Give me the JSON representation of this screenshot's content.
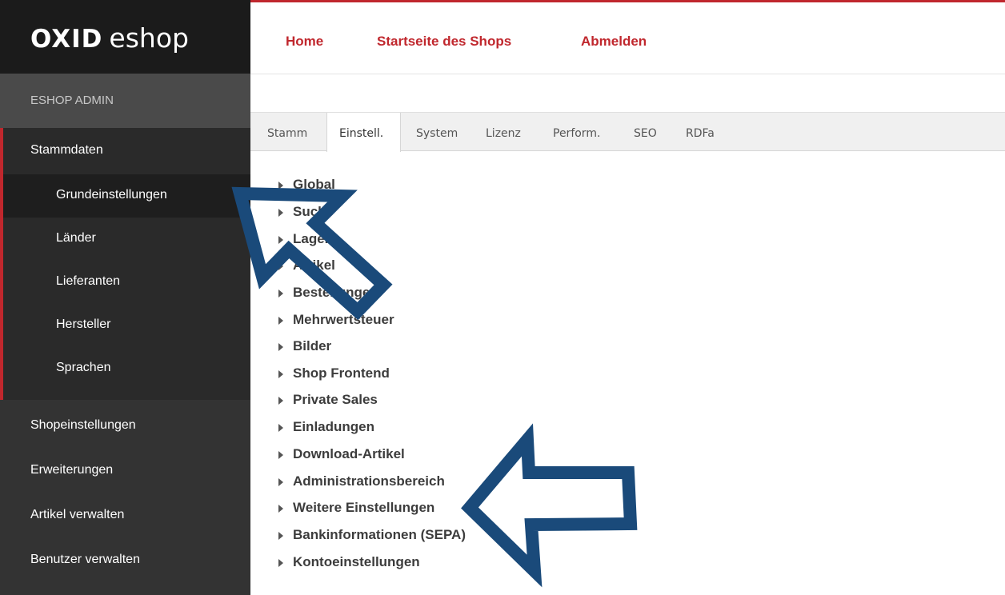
{
  "logo": {
    "part1": "OXID",
    "part2": "eshop"
  },
  "sidebar": {
    "header": "ESHOP ADMIN",
    "open_group": "Stammdaten",
    "sub_items": [
      {
        "label": "Grundeinstellungen",
        "active": true
      },
      {
        "label": "Länder",
        "active": false
      },
      {
        "label": "Lieferanten",
        "active": false
      },
      {
        "label": "Hersteller",
        "active": false
      },
      {
        "label": "Sprachen",
        "active": false
      }
    ],
    "items": [
      {
        "label": "Shopeinstellungen"
      },
      {
        "label": "Erweiterungen"
      },
      {
        "label": "Artikel verwalten"
      },
      {
        "label": "Benutzer verwalten"
      }
    ]
  },
  "topnav": {
    "home": "Home",
    "startseite": "Startseite des Shops",
    "abmelden": "Abmelden"
  },
  "tabs": [
    "Stamm",
    "Einstell.",
    "System",
    "Lizenz",
    "Perform.",
    "SEO",
    "RDFa"
  ],
  "active_tab": "Einstell.",
  "settings": [
    "Global",
    "Suche",
    "Lager",
    "Artikel",
    "Bestellungen",
    "Mehrwertsteuer",
    "Bilder",
    "Shop Frontend",
    "Private Sales",
    "Einladungen",
    "Download-Artikel",
    "Administrationsbereich",
    "Weitere Einstellungen",
    "Bankinformationen (SEPA)",
    "Kontoeinstellungen"
  ],
  "colors": {
    "accent": "#c0272d",
    "arrow": "#1a4a7a",
    "sidebar": "#333333",
    "logo_bar": "#1b1b1b"
  }
}
